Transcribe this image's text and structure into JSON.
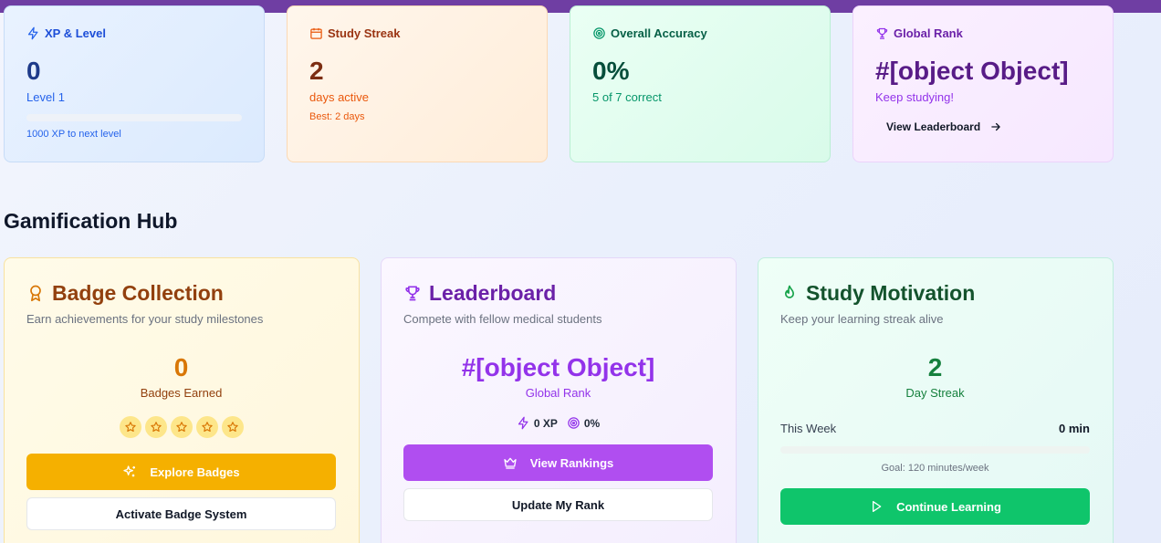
{
  "stats": {
    "xp": {
      "title": "XP & Level",
      "value": "0",
      "level": "Level 1",
      "next": "1000 XP to next level",
      "progress": 0
    },
    "streak": {
      "title": "Study Streak",
      "value": "2",
      "sub": "days active",
      "best": "Best: 2 days"
    },
    "accuracy": {
      "title": "Overall Accuracy",
      "value": "0%",
      "sub": "5 of 7 correct"
    },
    "rank": {
      "title": "Global Rank",
      "value": "#[object Object]",
      "sub": "Keep studying!",
      "link": "View Leaderboard"
    }
  },
  "section_title": "Gamification Hub",
  "badges": {
    "title": "Badge Collection",
    "desc": "Earn achievements for your study milestones",
    "count": "0",
    "label": "Badges Earned",
    "stars": 5,
    "explore": "Explore Badges",
    "activate": "Activate Badge System"
  },
  "leaderboard": {
    "title": "Leaderboard",
    "desc": "Compete with fellow medical students",
    "rank": "#[object Object]",
    "label": "Global Rank",
    "xp": "0 XP",
    "accuracy": "0%",
    "view": "View Rankings",
    "update": "Update My Rank"
  },
  "motivation": {
    "title": "Study Motivation",
    "desc": "Keep your learning streak alive",
    "streak": "2",
    "label": "Day Streak",
    "week_label": "This Week",
    "week_value": "0 min",
    "week_progress": 0,
    "goal": "Goal: 120 minutes/week",
    "continue": "Continue Learning"
  },
  "colors": {
    "xp": "#1d4ed8",
    "streak": "#c2410c",
    "accuracy": "#047857",
    "rank": "#6b21a8",
    "badge_accent": "#d97706",
    "badge_button": "#f5b000",
    "lead_accent": "#9333ea",
    "lead_button": "#b04ef0",
    "motiv_accent": "#15803d",
    "motiv_button": "#0fc56b"
  }
}
